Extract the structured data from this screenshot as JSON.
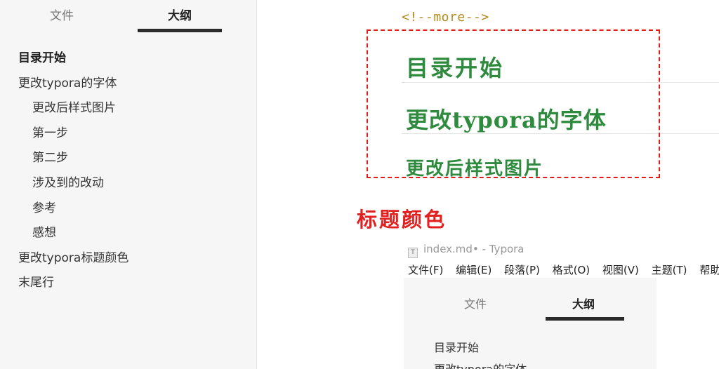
{
  "sidebar": {
    "tabs": {
      "files": "文件",
      "outline": "大纲"
    },
    "outline": [
      {
        "label": "目录开始",
        "level": 1,
        "active": true
      },
      {
        "label": "更改typora的字体",
        "level": 1
      },
      {
        "label": "更改后样式图片",
        "level": 2
      },
      {
        "label": "第一步",
        "level": 2
      },
      {
        "label": "第二步",
        "level": 2
      },
      {
        "label": "涉及到的改动",
        "level": 2
      },
      {
        "label": "参考",
        "level": 2
      },
      {
        "label": "感想",
        "level": 2
      },
      {
        "label": "更改typora标题颜色",
        "level": 1
      },
      {
        "label": "末尾行",
        "level": 1
      }
    ]
  },
  "editor": {
    "more_tag": "<!--more-->",
    "headings": {
      "h1a": "目录开始",
      "h1b": "更改typora的字体",
      "h2a": "更改后样式图片"
    },
    "annotation": "标题颜色",
    "heading_color": "#2e8b3e",
    "annotation_color": "#e32020"
  },
  "embedded": {
    "title": "index.md• - Typora",
    "menu": [
      "文件(F)",
      "编辑(E)",
      "段落(P)",
      "格式(O)",
      "视图(V)",
      "主题(T)",
      "帮助"
    ],
    "tabs": {
      "files": "文件",
      "outline": "大纲"
    },
    "items": [
      "目录开始",
      "更改typora的字体"
    ]
  }
}
